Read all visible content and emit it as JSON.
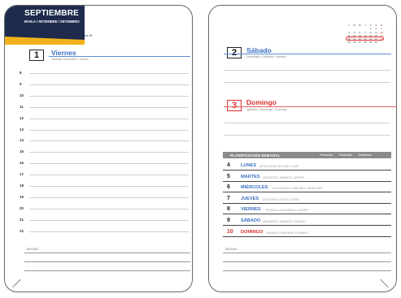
{
  "header": {
    "month": "SEPTIEMBRE",
    "month_translations": "IRAILA / SETEMBRE / SETEMBRO",
    "year": "2023",
    "week": "Semana 35"
  },
  "friday": {
    "number": "1",
    "name": "Viernes",
    "translations": "Ostirala / Divendres / Venres"
  },
  "hours": [
    "8",
    "9",
    "10",
    "11",
    "12",
    "13",
    "14",
    "15",
    "16",
    "17",
    "18",
    "19",
    "20",
    "21",
    "22"
  ],
  "notes_label": "NOTAS",
  "saturday": {
    "number": "2",
    "name": "Sábado",
    "translations": "Larunbata / Dissabte / Sábado"
  },
  "sunday": {
    "number": "3",
    "name": "Domingo",
    "translations": "Igandea / Diumenge / Domingo"
  },
  "mini_calendar": {
    "weekdays": [
      "L",
      "M",
      "M",
      "J",
      "V",
      "S",
      "D"
    ],
    "rows": [
      [
        "",
        "",
        "",
        "",
        "1",
        "2",
        "3"
      ],
      [
        "4",
        "5",
        "6",
        "7",
        "8",
        "9",
        "10"
      ],
      [
        "11",
        "12",
        "13",
        "14",
        "15",
        "16",
        "17"
      ],
      [
        "18",
        "19",
        "20",
        "21",
        "22",
        "23",
        "24"
      ],
      [
        "25",
        "26",
        "27",
        "28",
        "29",
        "30",
        ""
      ]
    ]
  },
  "planning": {
    "title": "PLANIFICACIÓN SEMANAL",
    "columns": [
      "Pendiente",
      "Realizado",
      "Realizado"
    ],
    "days": [
      {
        "number": "4",
        "name": "LUNES",
        "translations": "ASTELEHENA / DILLUNS / LUNS"
      },
      {
        "number": "5",
        "name": "MARTES",
        "translations": "ASTEARTEA / DIMARTS / MARTES"
      },
      {
        "number": "6",
        "name": "MIÉRCOLES",
        "translations": "ASTEAZKENA / DIMECRES / MÉRCORES"
      },
      {
        "number": "7",
        "name": "JUEVES",
        "translations": "OSTEGUNA / DIJOUS / XOVES"
      },
      {
        "number": "8",
        "name": "VIERNES",
        "translations": "OSTIRALA / DIVENDRES / VENRES"
      },
      {
        "number": "9",
        "name": "SÁBADO",
        "translations": "LARUNBATA / DISSABTE / SÁBADO"
      },
      {
        "number": "10",
        "name": "DOMINGO",
        "translations": "IGANDEA / DIUMENGE / DOMINGO"
      }
    ]
  },
  "colors": {
    "navy": "#1e2b4d",
    "yellow": "#f2b21b",
    "blue": "#3a6fbf",
    "red": "#e03030"
  }
}
